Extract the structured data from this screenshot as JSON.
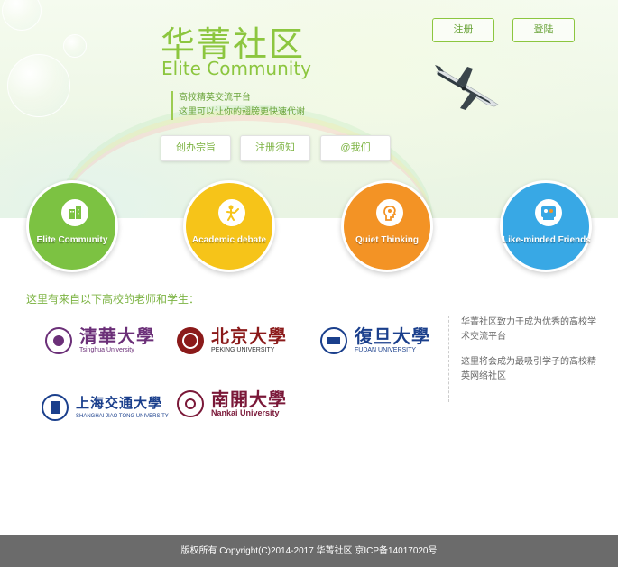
{
  "brand": {
    "title_cn": "华菁社区",
    "title_en": "Elite Community"
  },
  "tagline": [
    "高校精英交流平台",
    "这里可以让你的翅膀更快速代谢"
  ],
  "header_buttons": {
    "register": "注册",
    "login": "登陆"
  },
  "nav_buttons": [
    "创办宗旨",
    "注册须知",
    "@我们"
  ],
  "features": [
    {
      "label": "Elite Community",
      "color": "#7cc242",
      "icon": "community-building-icon"
    },
    {
      "label": "Academic debate",
      "color": "#f6c419",
      "icon": "debate-person-icon"
    },
    {
      "label": "Quiet Thinking",
      "color": "#f39325",
      "icon": "thinking-head-icon"
    },
    {
      "label": "Like-minded Friends",
      "color": "#38a8e5",
      "icon": "friends-group-icon"
    }
  ],
  "schools_title": "这里有来自以下高校的老师和学生：",
  "schools": [
    {
      "cn": "清華大學",
      "en": "Tsinghua University",
      "color": "#6b2f78"
    },
    {
      "cn": "北京大學",
      "en": "PEKING UNIVERSITY",
      "color": "#8b1a1a"
    },
    {
      "cn": "復旦大學",
      "en": "FUDAN UNIVERSITY",
      "color": "#1a3f8c"
    },
    {
      "cn": "上海交通大學",
      "en": "SHANGHAI JIAO TONG UNIVERSITY",
      "color": "#1a3f8c"
    },
    {
      "cn": "南開大學",
      "en": "Nankai University",
      "color": "#7a1838"
    }
  ],
  "side_text": [
    "华菁社区致力于成为优秀的高校学术交流平台",
    "这里将会成为最吸引学子的高校精英网络社区"
  ],
  "footer": "版权所有 Copyright(C)2014-2017 华菁社区 京ICP备14017020号"
}
